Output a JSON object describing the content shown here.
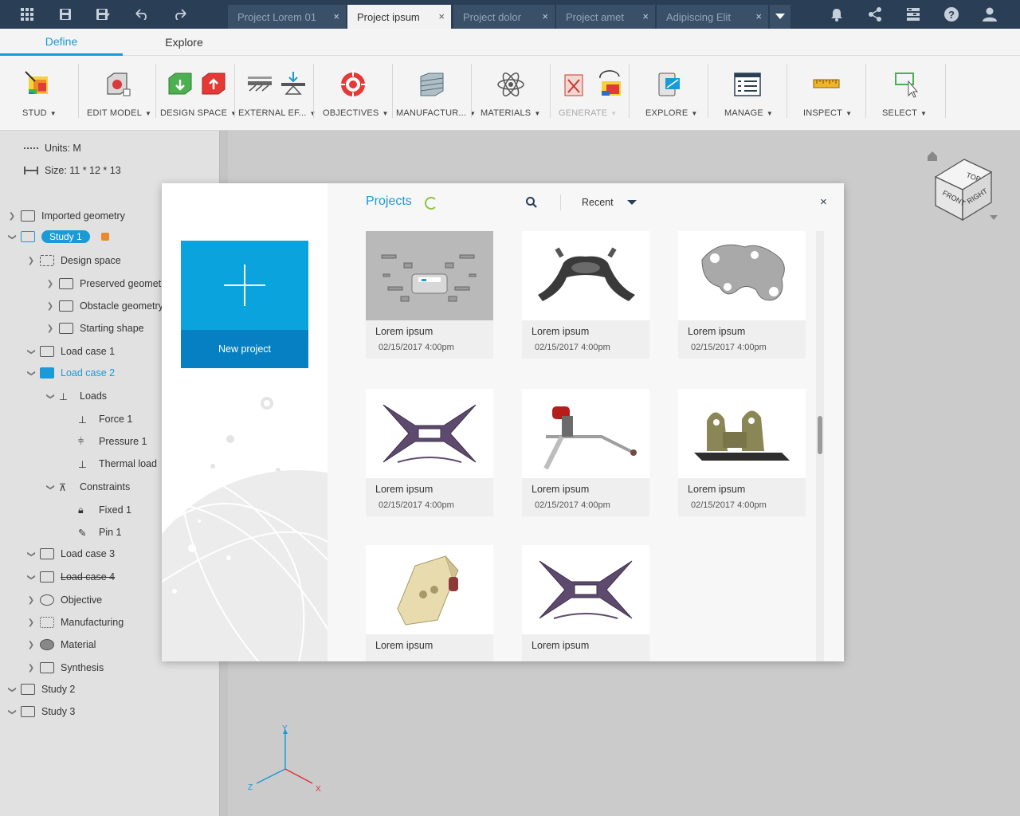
{
  "topbar": {
    "icons": [
      "apps-grid-icon",
      "save-icon",
      "save-as-icon",
      "undo-icon",
      "redo-icon"
    ],
    "right_icons": [
      "notification-bell-icon",
      "share-icon",
      "settings-panel-icon",
      "help-icon",
      "user-icon"
    ],
    "tabs": [
      {
        "label": "Project Lorem 01",
        "active": false
      },
      {
        "label": "Project ipsum",
        "active": true
      },
      {
        "label": "Project dolor",
        "active": false
      },
      {
        "label": "Project amet",
        "active": false
      },
      {
        "label": "Adipiscing Elit",
        "active": false
      }
    ],
    "tab_close": "×"
  },
  "modes": [
    {
      "label": "Define",
      "active": true
    },
    {
      "label": "Explore",
      "active": false
    }
  ],
  "ribbon": [
    {
      "label": "STUD",
      "disabled": false
    },
    {
      "label": "EDIT MODEL",
      "disabled": false
    },
    {
      "label": "DESIGN SPACE",
      "disabled": false
    },
    {
      "label": "EXTERNAL EF...",
      "disabled": false
    },
    {
      "label": "OBJECTIVES",
      "disabled": false
    },
    {
      "label": "MANUFACTUR...",
      "disabled": false
    },
    {
      "label": "MATERIALS",
      "disabled": false
    },
    {
      "label": "GENERATE",
      "disabled": true
    },
    {
      "label": "EXPLORE",
      "disabled": false
    },
    {
      "label": "MANAGE",
      "disabled": false
    },
    {
      "label": "INSPECT",
      "disabled": false
    },
    {
      "label": "SELECT",
      "disabled": false
    }
  ],
  "tree": {
    "units": "Units: M",
    "size": "Size: 11 * 12 * 13",
    "items": [
      {
        "label": "Imported geometry"
      },
      {
        "label": "Study 1"
      },
      {
        "label": "Design space"
      },
      {
        "label": "Preserved geometry"
      },
      {
        "label": "Obstacle geometry"
      },
      {
        "label": "Starting shape"
      },
      {
        "label": "Load case 1"
      },
      {
        "label": "Load case 2"
      },
      {
        "label": "Loads"
      },
      {
        "label": "Force 1"
      },
      {
        "label": "Pressure 1"
      },
      {
        "label": "Thermal load"
      },
      {
        "label": "Constraints"
      },
      {
        "label": "Fixed 1"
      },
      {
        "label": "Pin 1"
      },
      {
        "label": "Load case 3"
      },
      {
        "label": "Load case 4"
      },
      {
        "label": "Objective"
      },
      {
        "label": "Manufacturing"
      },
      {
        "label": "Material"
      },
      {
        "label": "Synthesis"
      },
      {
        "label": "Study 2"
      },
      {
        "label": "Study 3"
      }
    ]
  },
  "viewcube": {
    "top": "TOP",
    "front": "FRONT",
    "right": "RIGHT"
  },
  "axes": {
    "x": "X",
    "y": "Y",
    "z": "Z"
  },
  "colors": {
    "accent": "#1a9ad6",
    "topbar": "#2a3e55",
    "new_project": "#0aa3dd",
    "new_project_footer": "#0680c2",
    "spinner": "#8cc63f",
    "lock": "#e98a2c"
  },
  "modal": {
    "title": "Projects",
    "sort": "Recent",
    "close": "×",
    "new_project": "New project",
    "projects": [
      {
        "name": "Lorem ipsum",
        "date": "02/15/2017 4:00pm",
        "thumb": "drone-frame-parts"
      },
      {
        "name": "Lorem ipsum",
        "date": "02/15/2017 4:00pm",
        "thumb": "bracket-dark"
      },
      {
        "name": "Lorem ipsum",
        "date": "02/15/2017 4:00pm",
        "thumb": "bracket-silver"
      },
      {
        "name": "Lorem ipsum",
        "date": "02/15/2017 4:00pm",
        "thumb": "drone-frame-purple"
      },
      {
        "name": "Lorem ipsum",
        "date": "02/15/2017 4:00pm",
        "thumb": "bike-suspension"
      },
      {
        "name": "Lorem ipsum",
        "date": "02/15/2017 4:00pm",
        "thumb": "mount-bracket"
      },
      {
        "name": "Lorem ipsum",
        "date": "",
        "thumb": "clamp-block"
      },
      {
        "name": "Lorem ipsum",
        "date": "",
        "thumb": "drone-frame-purple"
      }
    ]
  }
}
